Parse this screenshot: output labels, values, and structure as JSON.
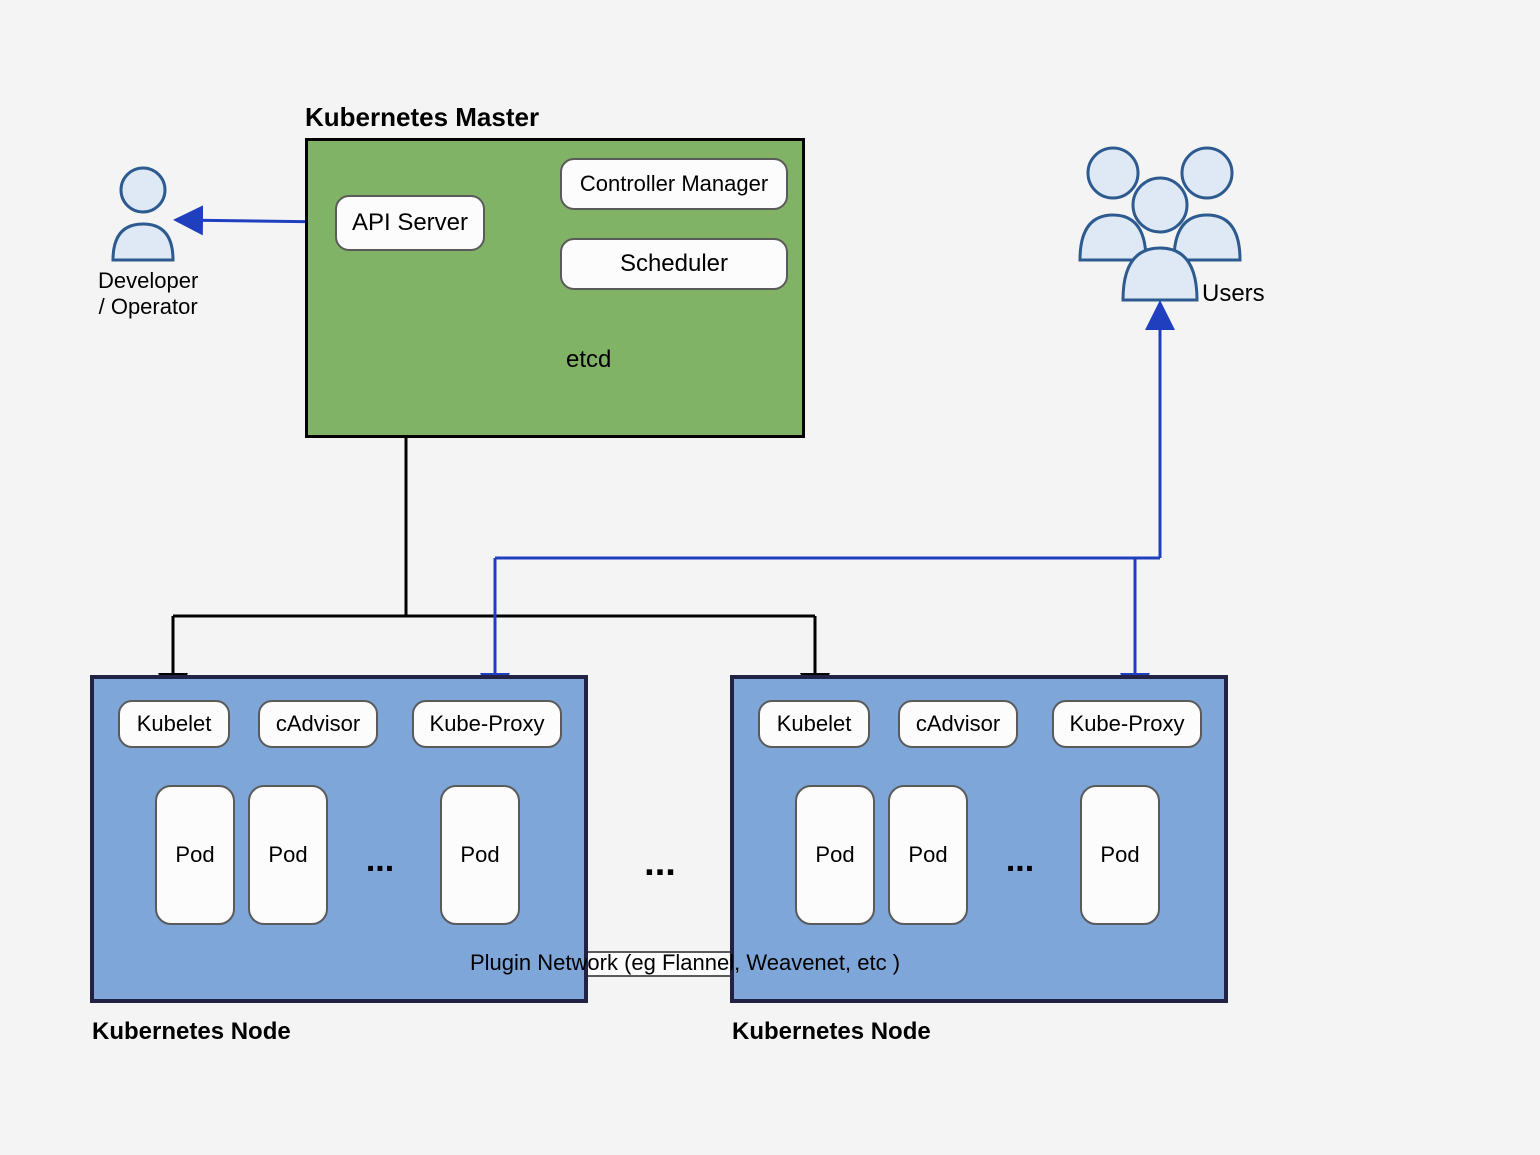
{
  "titles": {
    "master": "Kubernetes Master",
    "node": "Kubernetes Node",
    "developer": "Developer\n/ Operator",
    "users": "Users",
    "network": "Plugin Network (eg Flannel, Weavenet, etc )",
    "ellipsis": "...",
    "big_ellipsis": "..."
  },
  "master": {
    "api": "API Server",
    "controller": "Controller Manager",
    "scheduler": "Scheduler",
    "etcd": "etcd"
  },
  "node": {
    "kubelet": "Kubelet",
    "cadvisor": "cAdvisor",
    "kubeproxy": "Kube-Proxy",
    "pod": "Pod"
  },
  "colors": {
    "blue": "#1f3fbf",
    "black": "#000000",
    "user_fill": "#dfe9f5",
    "user_stroke": "#2d5a8f"
  }
}
